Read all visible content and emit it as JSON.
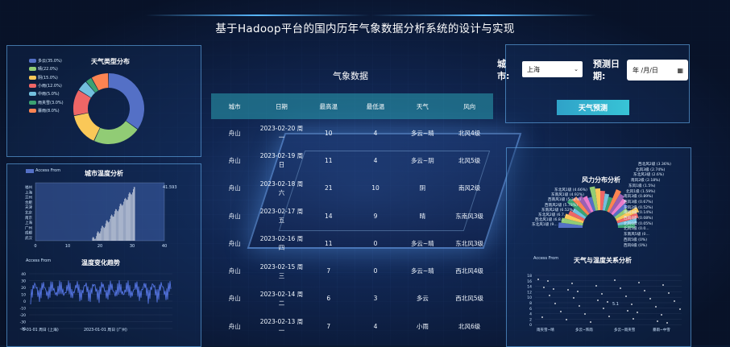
{
  "title": "基于Hadoop平台的国内历年气象数据分析系统的设计与实现",
  "weather_type": {
    "title": "天气类型分布",
    "legend": [
      {
        "label": "多云(35.0%)",
        "color": "#5470c6"
      },
      {
        "label": "晴(22.0%)",
        "color": "#91cc75"
      },
      {
        "label": "阴(15.0%)",
        "color": "#fac858"
      },
      {
        "label": "小雨(12.0%)",
        "color": "#ee6666"
      },
      {
        "label": "中雨(5.0%)",
        "color": "#73c0de"
      },
      {
        "label": "雨夹雪(3.0%)",
        "color": "#3ba272"
      },
      {
        "label": "暴雨(8.0%)",
        "color": "#fc8452"
      }
    ]
  },
  "city_temp": {
    "title": "城市温度分析",
    "legend": "Access From",
    "max_label": "41.593",
    "y_labels": [
      "福州",
      "上海",
      "兰州",
      "合肥",
      "天津",
      "北京",
      "南京",
      "上海",
      "广州",
      "成都",
      "武汉"
    ],
    "x_ticks": [
      "0",
      "10",
      "20",
      "30",
      "40"
    ]
  },
  "temp_trend": {
    "title": "温度变化趋势",
    "legend": "Access From",
    "y_ticks": [
      "40",
      "30",
      "20",
      "10",
      "0",
      "-10",
      "-20",
      "-30",
      "-40"
    ],
    "x_ticks": [
      "3-01-01 周日 (上海)",
      "2023-01-01 周日 (广州)"
    ]
  },
  "table": {
    "section_title": "气象数据",
    "headers": [
      "城市",
      "日期",
      "最高温",
      "最低温",
      "天气",
      "风向"
    ],
    "rows": [
      [
        "舟山",
        "2023-02-20 周一",
        "10",
        "4",
        "多云~晴",
        "北风4级"
      ],
      [
        "舟山",
        "2023-02-19 周日",
        "11",
        "4",
        "多云~阴",
        "北风5级"
      ],
      [
        "舟山",
        "2023-02-18 周六",
        "21",
        "10",
        "阴",
        "南风2级"
      ],
      [
        "舟山",
        "2023-02-17 周五",
        "14",
        "9",
        "晴",
        "东南风3级"
      ],
      [
        "舟山",
        "2023-02-16 周四",
        "11",
        "0",
        "多云~晴",
        "东北风3级"
      ],
      [
        "舟山",
        "2023-02-15 周三",
        "7",
        "0",
        "多云~晴",
        "西北风4级"
      ],
      [
        "舟山",
        "2023-02-14 周二",
        "6",
        "3",
        "多云",
        "西北风5级"
      ],
      [
        "舟山",
        "2023-02-13 周一",
        "7",
        "4",
        "小雨",
        "北风6级"
      ]
    ]
  },
  "controls": {
    "city_label": "城市:",
    "city_value": "上海",
    "date_label": "预测日期:",
    "date_placeholder": "年 /月/日",
    "predict_button": "天气预测"
  },
  "wind": {
    "title": "风力分布分析",
    "labels_right": [
      "西北风2级 (3.36%)",
      "北风3级 (2.74%)",
      "东北风3级 (2.6%)",
      "南风2级 (2.18%)",
      "东风1级 (1.5%)",
      "北风1级 (1.59%)",
      "南风3级 (0.89%)",
      "西风3级 (0.67%)",
      "东风2级 (0.52%)",
      "南风4级 (0.14%)",
      "西风4级 (0.08%)",
      "北风6级 (0.05%)",
      "北风5级 (0.0...",
      "东南风5级 (0...",
      "西风5级 (0%)",
      "西风6级 (0%)"
    ],
    "labels_left": [
      "东北风1级 (4.66%)",
      "东南风1级 (4.92%)",
      "西南风1级 (5.34%)",
      "西南风2级 (5.78%)",
      "东南风2级 (6.52%)",
      "东北风2级 (6.7...",
      "西北风1级 (6.8...",
      "东北风1级 (9..."
    ]
  },
  "weather_temp": {
    "title": "天气与温度关系分析",
    "legend": "Access From",
    "y_ticks": [
      "18",
      "16",
      "14",
      "12",
      "10",
      "8",
      "6",
      "4",
      "2",
      "0"
    ],
    "x_ticks": [
      "雨夹雪~晴",
      "多云~阵雨",
      "多云~雨夹雪",
      "暴雨~中雪"
    ],
    "point_label": "5.1"
  }
}
